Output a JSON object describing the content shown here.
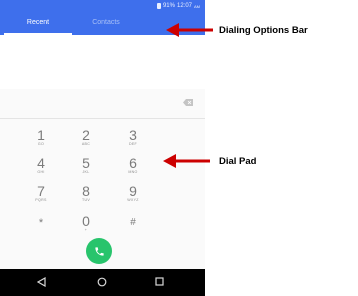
{
  "status_bar": {
    "battery": "91%",
    "time": "12:07",
    "ampm": "AM"
  },
  "tabs": [
    {
      "label": "Recent",
      "active": true
    },
    {
      "label": "Contacts",
      "active": false
    }
  ],
  "dialpad": {
    "keys": [
      {
        "digit": "1",
        "letters": "GO"
      },
      {
        "digit": "2",
        "letters": "ABC"
      },
      {
        "digit": "3",
        "letters": "DEF"
      },
      {
        "digit": "4",
        "letters": "GHI"
      },
      {
        "digit": "5",
        "letters": "JKL"
      },
      {
        "digit": "6",
        "letters": "MNO"
      },
      {
        "digit": "7",
        "letters": "PQRS"
      },
      {
        "digit": "8",
        "letters": "TUV"
      },
      {
        "digit": "9",
        "letters": "WXYZ"
      },
      {
        "digit": "*",
        "letters": ""
      },
      {
        "digit": "0",
        "letters": "+"
      },
      {
        "digit": "#",
        "letters": ""
      }
    ]
  },
  "icons": {
    "backspace": "backspace-icon",
    "call": "phone-call-icon",
    "nav_back": "back-triangle-icon",
    "nav_home": "home-circle-icon",
    "nav_recents": "recents-square-icon"
  },
  "annotations": {
    "dialing_options_bar": "Dialing Options Bar",
    "dial_pad": "Dial Pad"
  },
  "colors": {
    "primary": "#3e6fec",
    "call_button": "#28c46c",
    "annotation_arrow": "#cc0000"
  }
}
